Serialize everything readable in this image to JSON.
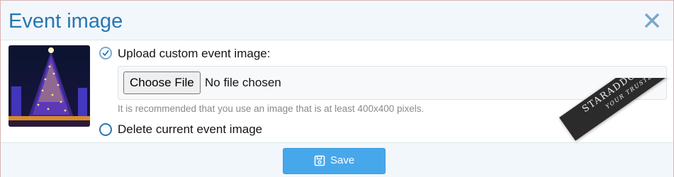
{
  "dialog": {
    "title": "Event image",
    "close_icon": "close-x-icon",
    "accent_color": "#2577b1"
  },
  "image": {
    "icon": "christmas-tree-thumbnail"
  },
  "options": {
    "upload": {
      "label": "Upload custom event image:",
      "checked": true
    },
    "delete": {
      "label": "Delete current event image",
      "checked": false
    }
  },
  "file_input": {
    "button_label": "Choose File",
    "status": "No file chosen"
  },
  "hint": "It is recommended that you use an image that is at least 400x400 pixels.",
  "footer": {
    "save_label": "Save",
    "save_icon": "floppy-disk-icon",
    "button_color": "#47a7eb"
  },
  "watermark": {
    "line1": "STARADDONS.STORE",
    "line2": "YOUR TRUSTED HUB"
  }
}
